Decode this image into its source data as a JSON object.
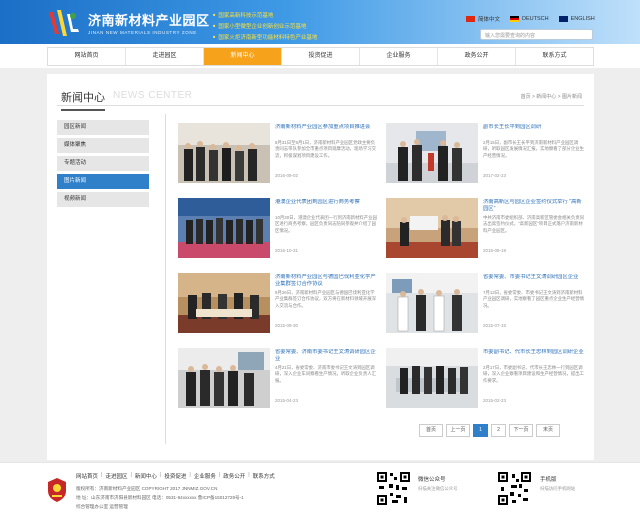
{
  "header": {
    "logo_cn": "济南新材料产业园区",
    "logo_en": "JINAN NEW MATERIALS INDUSTRY ZONE",
    "slogans": [
      "国家高新科技示范基地",
      "国家小型微型企业创新创业示范基地",
      "国家火炬济南新型功能材料特色产业基地"
    ],
    "languages": [
      "简体中文",
      "DEUTSCH",
      "ENGLISH"
    ],
    "search_placeholder": "输入您需要查询的内容"
  },
  "nav": [
    "网站首页",
    "走进园区",
    "新闻中心",
    "投资促进",
    "企业服务",
    "政务公开",
    "联系方式"
  ],
  "nav_active": 2,
  "section": {
    "title_cn": "新闻中心",
    "title_en": "NEWS CENTER",
    "breadcrumb": "首页 > 新闻中心 > 图片新闻"
  },
  "sidebar": [
    "园区新闻",
    "媒体聚焦",
    "专题活动",
    "图片新闻",
    "视频新闻"
  ],
  "sidebar_active": 3,
  "news": [
    {
      "title": "济南新材料产业园区参加重点项目推进会",
      "summary": "8月31日至9月1日，济南新材料产业园区党政主要负责同志带队参加全市重点项目观摩活动，现场学习交流，积极谋划项目建设工作。",
      "date": "2016-09-02"
    },
    {
      "title": "副市长王长平到园区调研",
      "summary": "2月15日，副市长王长平到济南新材料产业园区调研，听取园区发展情况汇报，实地察看了部分企业生产经营情况。",
      "date": "2017-02-23"
    },
    {
      "title": "港澳企业代表团到园区进行商务考察",
      "summary": "10月30日，港澳企业代表团一行到济南新材料产业园区进行商务考察，园区负责同志陪同参观并介绍了园区情况。",
      "date": "2016-10-31"
    },
    {
      "title": "济南高新区与园区企业签约仪式举行 \"高新园区\"",
      "summary": "中共济南市委组织部、济南高新区管委会相关负责同志出席签约仪式，\"高新园区\"项目正式落户济南新材料产业园区。",
      "date": "2016-08-19"
    },
    {
      "title": "济南新材料产业园区与德国巴伐利亚化学产业集群签订合作协议",
      "summary": "9月26日，济南新材料产业园区与德国巴伐利亚化学产业集群签订合作协议，双方将在新材料领域开展深入交流与合作。",
      "date": "2015-09-30"
    },
    {
      "title": "省委常委、市委书记王文涛调研园区企业",
      "summary": "7月13日，省委常委、市委书记王文涛到济南新材料产业园区调研，实地察看了园区重点企业生产经营情况。",
      "date": "2015-07-15"
    },
    {
      "title": "省委常委、济南市委书记王文涛调研园区企业",
      "summary": "4月21日，省委常委、济南市委书记王文涛到园区调研，深入企业车间察看生产情况，听取企业负责人汇报。",
      "date": "2015-04-23"
    },
    {
      "title": "市委副书记、代市长王忠林到园区调研企业",
      "summary": "2月17日，市委副书记、代市长王忠林一行到园区调研，深入企业察看项目建设和生产经营情况，提出工作要求。",
      "date": "2015-02-23"
    }
  ],
  "pager": {
    "first": "首页",
    "prev": "上一页",
    "pages": [
      "1",
      "2"
    ],
    "active": "1",
    "next": "下一页",
    "last": "末页"
  },
  "footer": {
    "links": [
      "网站首页",
      "走进园区",
      "新闻中心",
      "投资促进",
      "企业服务",
      "政务公开",
      "联系方式"
    ],
    "copyright": "版权所有：济南新材料产业园区 COPYRIGHT 2017 JNNMIZ.GOV.CN",
    "address": "地 址：山东济南市济阳县新材料园区 电话：0531-84xxxxxx 鲁ICP备15012729号-1",
    "extra": "综合管理办公室 运营管理",
    "qr1_label": "微信公众号",
    "qr1_sub": "扫描关注微信公众号",
    "qr2_label": "手机版",
    "qr2_sub": "扫描访问手机网站"
  },
  "colors": {
    "header": "#1b6fc6",
    "accent_orange": "#f7a21b",
    "accent_blue": "#2f7fc9"
  }
}
